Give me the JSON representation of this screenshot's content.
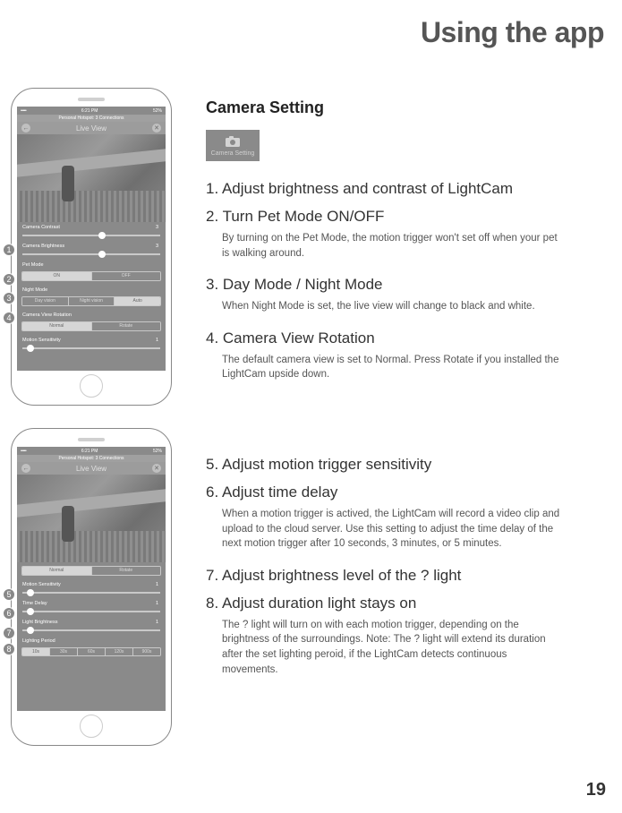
{
  "page": {
    "title": "Using the app",
    "section_title": "Camera Setting",
    "camera_setting_label": "Camera Setting",
    "page_number": "19"
  },
  "phone_common": {
    "time": "6:21 PM",
    "battery": "52%",
    "hotspot": "Personal Hotspot: 3 Connections",
    "title": "Live View"
  },
  "phone1": {
    "rows": {
      "contrast_label": "Camera Contrast",
      "contrast_val": "3",
      "brightness_label": "Camera Brightness",
      "brightness_val": "3",
      "petmode_label": "Pet Mode",
      "petmode_on": "ON",
      "petmode_off": "OFF",
      "nightmode_label": "Night Mode",
      "nm_day": "Day vision",
      "nm_night": "Night vision",
      "nm_auto": "Auto",
      "rotation_label": "Camera View Rotation",
      "rot_normal": "Normal",
      "rot_rotate": "Rotate",
      "motion_label": "Motion Sensitivity",
      "motion_val": "1"
    }
  },
  "phone2": {
    "rows": {
      "rot_normal": "Normal",
      "rot_rotate": "Rotate",
      "motion_label": "Motion Sensitivity",
      "motion_val": "1",
      "time_delay_label": "Time Delay",
      "time_delay_val": "1",
      "light_brightness_label": "Light Brightness",
      "light_brightness_val": "1",
      "lighting_period_label": "Lighting Period",
      "lp1": "10s",
      "lp2": "30s",
      "lp3": "60s",
      "lp4": "120s",
      "lp5": "900s"
    }
  },
  "badges": {
    "b1": "1",
    "b2": "2",
    "b3": "3",
    "b4": "4",
    "b5": "5",
    "b6": "6",
    "b7": "7",
    "b8": "8"
  },
  "items": {
    "i1": "1.  Adjust brightness and contrast of LightCam",
    "i2": "2. Turn Pet Mode ON/OFF",
    "i2sub": "By turning on the Pet Mode, the motion trigger won't set off when your pet is walking around.",
    "i3": "3. Day Mode / Night Mode",
    "i3sub": "When Night Mode is set, the live view will change to black and white.",
    "i4": "4. Camera View Rotation",
    "i4sub": "The default camera view is set to Normal. Press Rotate if you installed the LightCam upside down.",
    "i5": "5. Adjust motion trigger sensitivity",
    "i6": "6. Adjust time delay",
    "i6sub": "When a motion trigger is actived, the LightCam will record a video clip and upload to the cloud server.  Use this setting to adjust the time delay of the next motion trigger after 10 seconds, 3 minutes, or 5 minutes.",
    "i7": "7. Adjust brightness level of the ? light",
    "i8": "8. Adjust duration light stays on",
    "i8sub": "The ? light will turn on with each motion trigger, depending on the brightness of the surroundings.  Note:  The ? light will extend its duration after the set lighting peroid, if the LightCam detects continuous movements."
  }
}
